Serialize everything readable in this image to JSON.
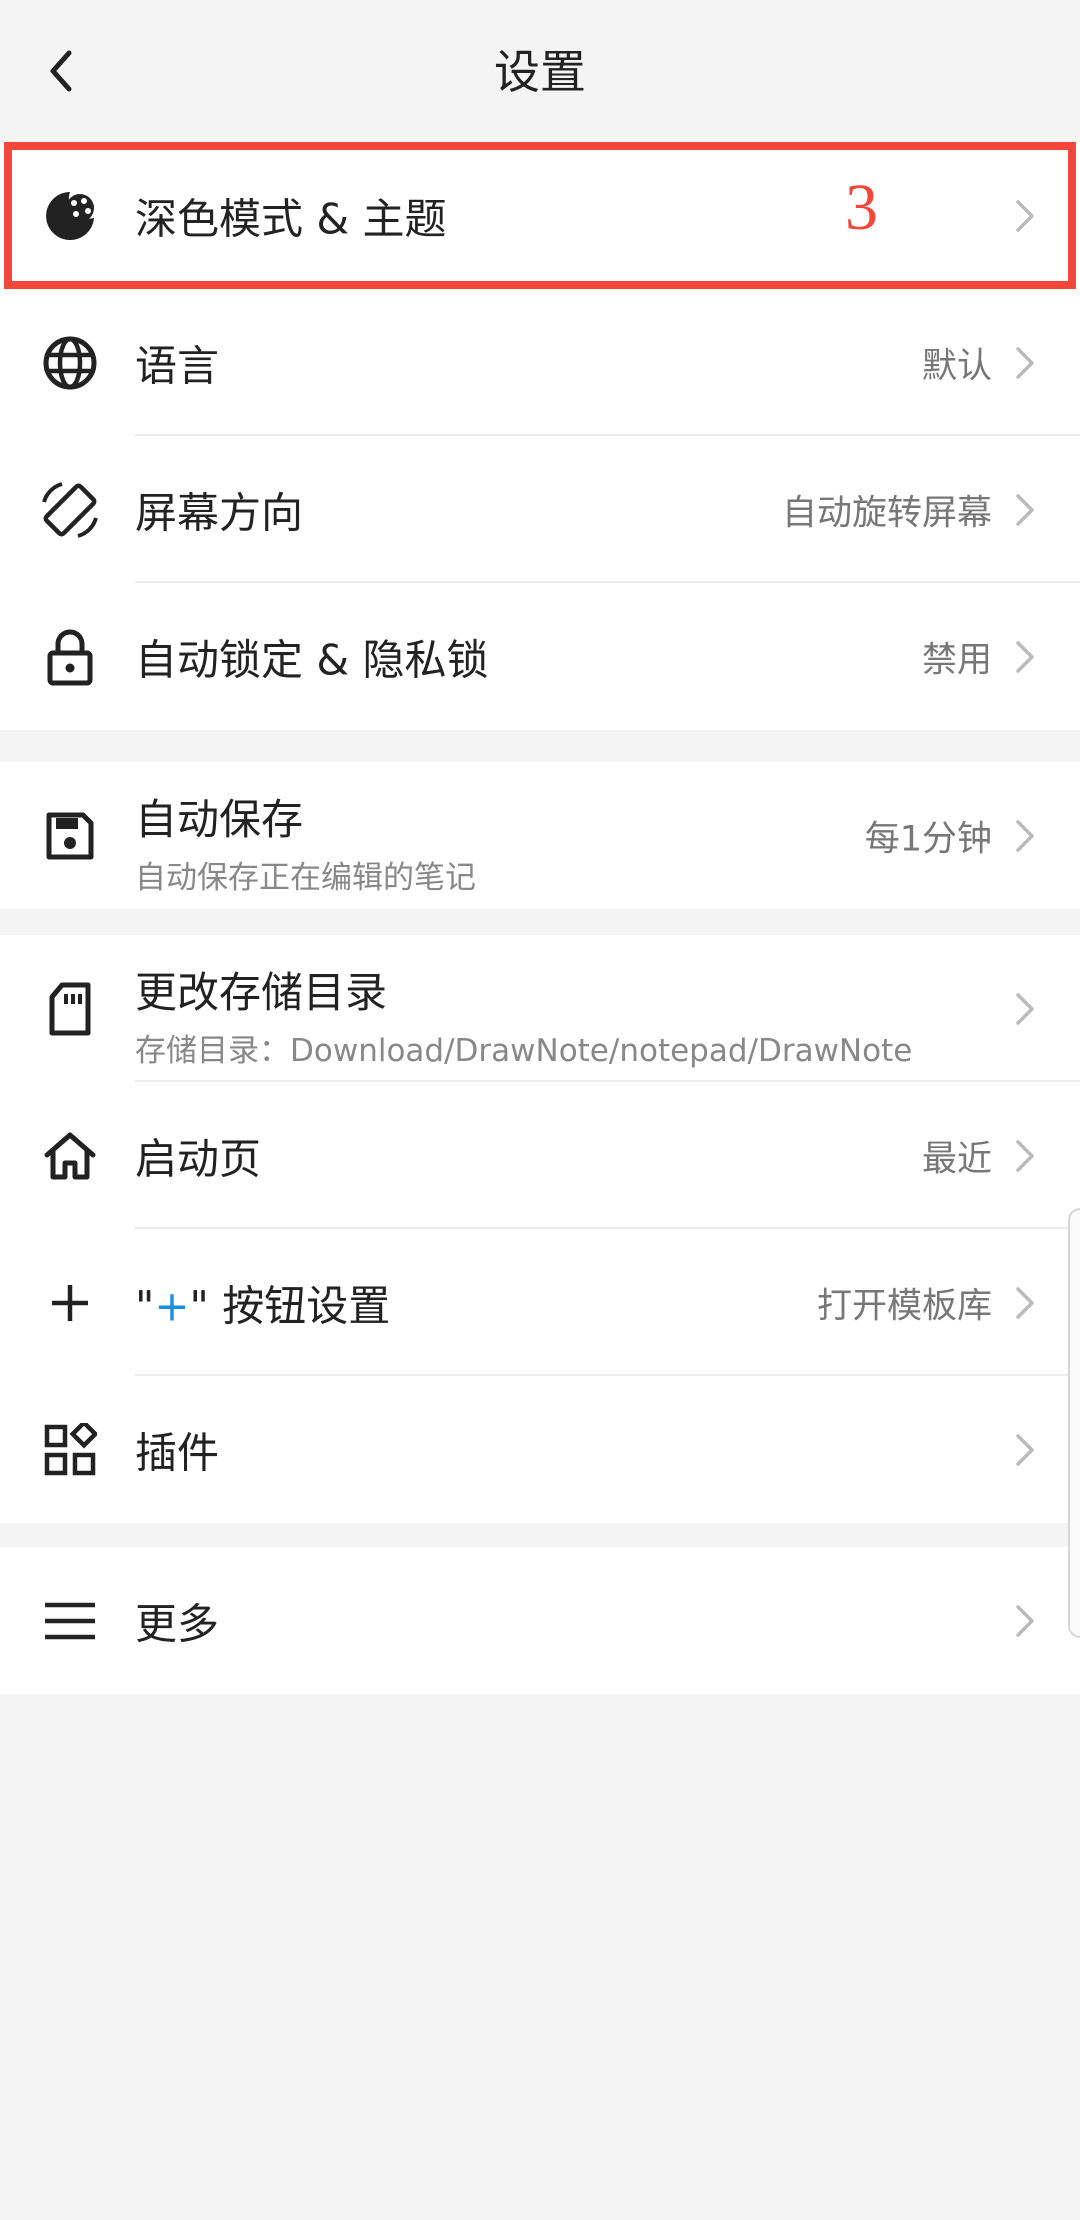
{
  "header": {
    "title": "设置"
  },
  "groups": {
    "g1": {
      "theme": {
        "label": "深色模式 & 主题",
        "icon": "palette-moon-icon"
      },
      "language": {
        "label": "语言",
        "value": "默认",
        "icon": "globe-icon"
      },
      "orientation": {
        "label": "屏幕方向",
        "value": "自动旋转屏幕",
        "icon": "screen-rotation-icon"
      },
      "lock": {
        "label": "自动锁定 & 隐私锁",
        "value": "禁用",
        "icon": "lock-icon"
      }
    },
    "g2": {
      "autosave": {
        "label": "自动保存",
        "sub": "自动保存正在编辑的笔记",
        "value": "每1分钟",
        "icon": "save-icon"
      }
    },
    "g3": {
      "storage": {
        "label": "更改存储目录",
        "sub": "存储目录：Download/DrawNote/notepad/DrawNote",
        "icon": "sd-card-icon"
      },
      "startpage": {
        "label": "启动页",
        "value": "最近",
        "icon": "home-icon"
      },
      "plusbtn": {
        "label_q1": "\"",
        "label_plus": "+",
        "label_q2": "\" 按钮设置",
        "value": "打开模板库",
        "icon": "plus-icon"
      },
      "plugins": {
        "label": "插件",
        "icon": "widgets-icon"
      }
    },
    "g4": {
      "more": {
        "label": "更多",
        "icon": "menu-icon"
      }
    }
  },
  "annotation": {
    "marker": "3"
  },
  "colors": {
    "accent_red": "#f4463a",
    "plus_blue": "#1a8fe0"
  }
}
